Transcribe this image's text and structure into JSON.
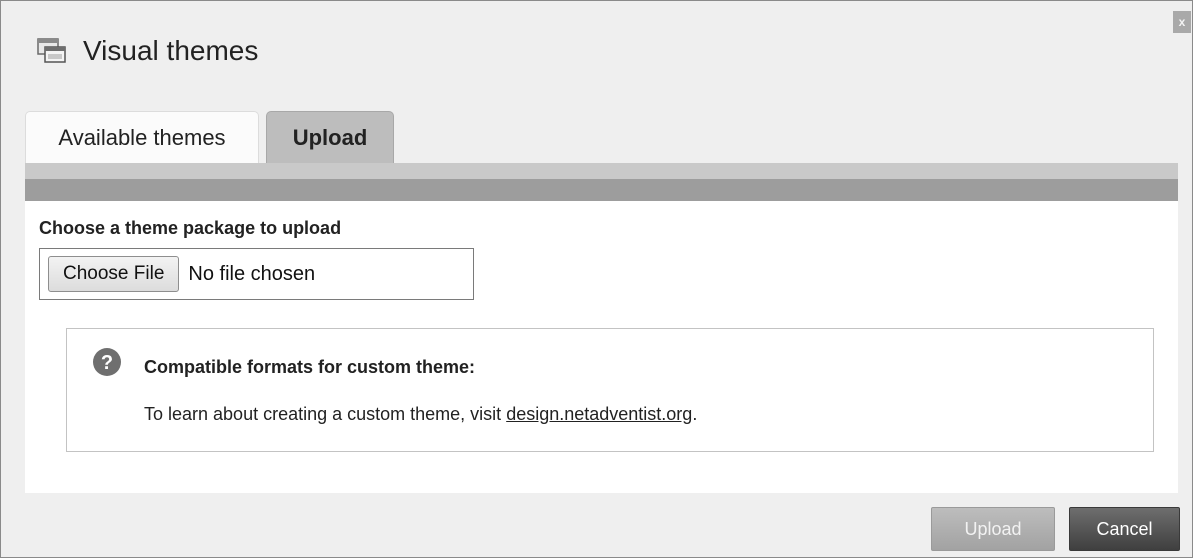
{
  "dialog": {
    "title": "Visual themes",
    "close_label": "x",
    "title_icon": "windows-icon"
  },
  "tabs": [
    {
      "label": "Available themes",
      "active": false
    },
    {
      "label": "Upload",
      "active": true
    }
  ],
  "upload": {
    "label": "Choose a theme package to upload",
    "choose_file_label": "Choose File",
    "no_file_text": "No file chosen"
  },
  "info": {
    "icon": "help-icon",
    "heading": "Compatible formats for custom theme:",
    "text_prefix": "To learn about creating a custom theme, visit ",
    "link_text": "design.netadventist.org",
    "text_suffix": "."
  },
  "footer": {
    "upload_label": "Upload",
    "cancel_label": "Cancel"
  }
}
